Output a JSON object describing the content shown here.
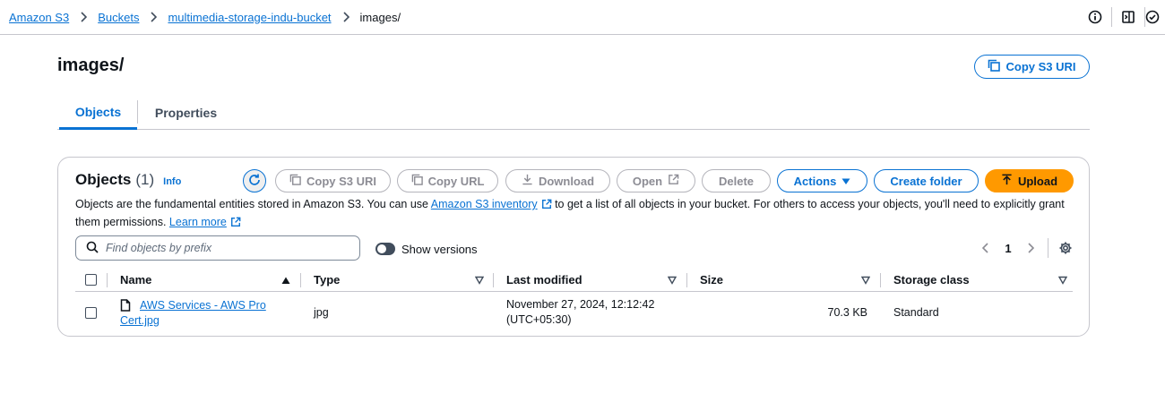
{
  "breadcrumb": {
    "items": [
      "Amazon S3",
      "Buckets",
      "multimedia-storage-indu-bucket"
    ],
    "current": "images/"
  },
  "header": {
    "title": "images/",
    "copy_uri_label": "Copy S3 URI"
  },
  "tabs": [
    {
      "label": "Objects",
      "active": true
    },
    {
      "label": "Properties",
      "active": false
    }
  ],
  "objects_panel": {
    "title": "Objects",
    "count": "(1)",
    "info": "Info",
    "buttons": {
      "copy_uri": "Copy S3 URI",
      "copy_url": "Copy URL",
      "download": "Download",
      "open": "Open",
      "delete": "Delete",
      "actions": "Actions",
      "create_folder": "Create folder",
      "upload": "Upload"
    },
    "description_1": "Objects are the fundamental entities stored in Amazon S3. You can use ",
    "description_link": "Amazon S3 inventory",
    "description_2": " to get a list of all objects in your bucket. For others to access your objects, you'll need to explicitly grant them permissions.",
    "learn_more": "Learn more",
    "search_placeholder": "Find objects by prefix",
    "show_versions": "Show versions",
    "page": "1"
  },
  "table": {
    "columns": [
      "Name",
      "Type",
      "Last modified",
      "Size",
      "Storage class"
    ],
    "rows": [
      {
        "name": "AWS Services - AWS Pro Cert.jpg",
        "type": "jpg",
        "last_modified": "November 27, 2024, 12:12:42 (UTC+05:30)",
        "size": "70.3 KB",
        "storage_class": "Standard"
      }
    ]
  },
  "colors": {
    "link": "#0972d3",
    "primary": "#ff9900",
    "disabled": "#8c8c94",
    "border": "#c6c6cd"
  },
  "icons": [
    "chevron-right-icon",
    "info-circle-icon",
    "panel-icon",
    "settings-icon",
    "copy-icon",
    "refresh-icon",
    "download-icon",
    "external-link-icon",
    "caret-down-icon",
    "upload-icon",
    "search-icon",
    "file-icon",
    "sort-up-icon",
    "sort-down-icon",
    "gear-icon"
  ]
}
